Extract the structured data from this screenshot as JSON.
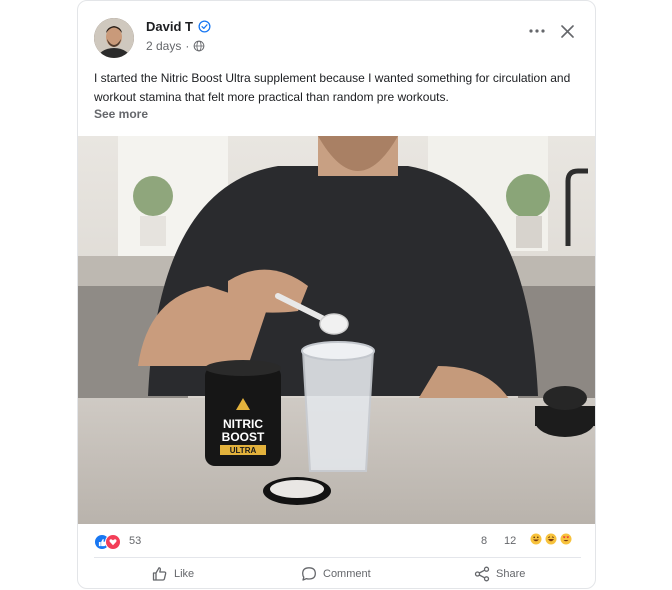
{
  "post": {
    "author": "David T",
    "time": "2 days",
    "separator": "·",
    "text": "I started the Nitric Boost Ultra supplement because I wanted something for circulation and workout stamina that felt more practical than random pre workouts.",
    "see_more": "See more"
  },
  "photo": {
    "product_brand_line1": "NITRIC",
    "product_brand_line2": "BOOST",
    "product_sub": "ULTRA"
  },
  "stats": {
    "reaction_count": "53",
    "stat_a": "8",
    "stat_b": "12"
  },
  "actions": {
    "like": "Like",
    "comment": "Comment",
    "share": "Share"
  },
  "icons": [
    "verified-icon",
    "globe-icon",
    "more-icon",
    "close-icon",
    "like-reaction-icon",
    "love-reaction-icon",
    "like-icon",
    "comment-icon",
    "share-icon"
  ],
  "colors": {
    "verified": "#1877f2",
    "like": "#1877f2",
    "love": "#f33e58",
    "text_secondary": "#65676b"
  }
}
